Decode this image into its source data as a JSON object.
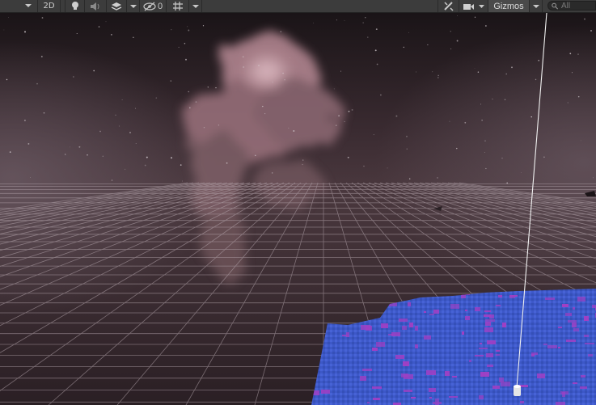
{
  "toolbar": {
    "mode_2d_label": "2D",
    "hidden_count": "0",
    "gizmos_label": "Gizmos",
    "search_placeholder": "All"
  },
  "icons": {
    "dropdown": "chevron-down-icon",
    "lighting": "lightbulb-icon",
    "audio": "speaker-icon",
    "effects": "layers-icon",
    "visibility": "eye-slash-icon",
    "grid": "grid-snap-icon",
    "tools": "wrench-icon",
    "camera": "camera-icon",
    "search": "search-icon"
  },
  "colors": {
    "toolbar_bg": "#3c3c3c",
    "sky_top": "#1a1417",
    "nebula": "#d8a3ae",
    "grid_line": "#b8a9b0",
    "terrain_blue": "#3b57c9",
    "terrain_purple": "#a13fc4",
    "gizmo_line": "#f2f2f2"
  }
}
